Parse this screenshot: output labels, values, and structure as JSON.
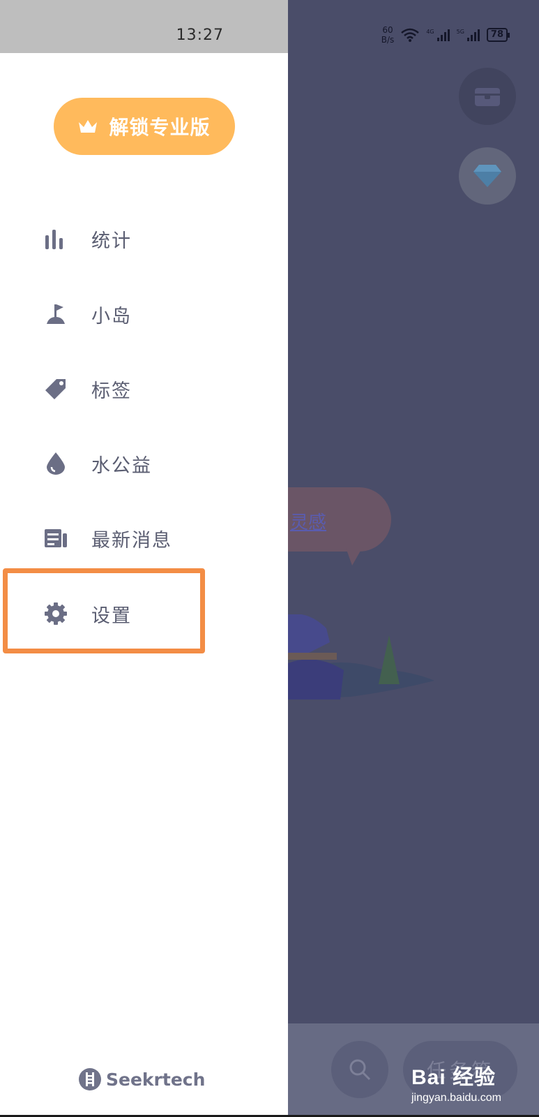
{
  "status_bar": {
    "time": "13:27",
    "net_speed_value": "60",
    "net_speed_unit": "B/s",
    "signal_1_label": "4G",
    "signal_2_label": "5G",
    "battery": "78"
  },
  "drawer": {
    "unlock_button_label": "解锁专业版",
    "menu_items": [
      {
        "label": "统计",
        "icon": "bar-chart-icon"
      },
      {
        "label": "小岛",
        "icon": "island-flag-icon"
      },
      {
        "label": "标签",
        "icon": "tag-icon"
      },
      {
        "label": "水公益",
        "icon": "water-drop-icon"
      },
      {
        "label": "最新消息",
        "icon": "news-icon"
      },
      {
        "label": "设置",
        "icon": "gear-icon"
      }
    ],
    "footer_brand": "Seekrtech"
  },
  "background_app": {
    "bubble_text": "灵感",
    "task_button_label": "任务箱"
  },
  "watermark": {
    "brand": "Bai 经验",
    "url": "jingyan.baidu.com"
  },
  "colors": {
    "accent_orange": "#ffba5c",
    "highlight_border": "#f38d45",
    "menu_text": "#5b5e72",
    "overlay": "#4a4d69"
  }
}
